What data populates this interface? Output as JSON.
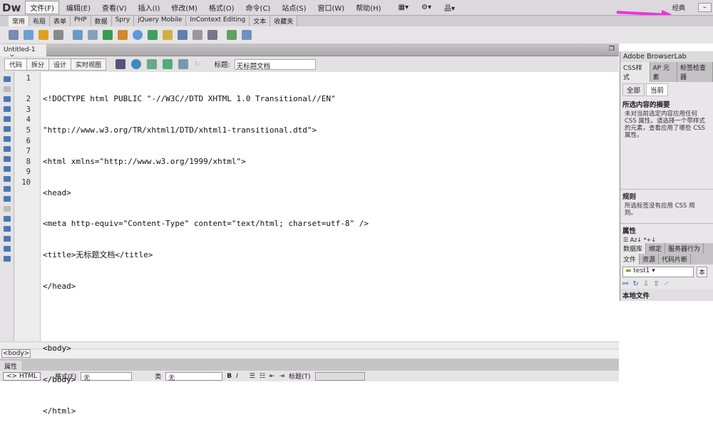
{
  "app": {
    "logo": "Dw",
    "workspace": "经典",
    "minimize": "–"
  },
  "menu": [
    "文件(F)",
    "编辑(E)",
    "查看(V)",
    "插入(I)",
    "修改(M)",
    "格式(O)",
    "命令(C)",
    "站点(S)",
    "窗口(W)",
    "帮助(H)"
  ],
  "insert_tabs": [
    "常用",
    "布局",
    "表单",
    "PHP",
    "数据",
    "Spry",
    "jQuery Mobile",
    "InContext Editing",
    "文本",
    "收藏夹"
  ],
  "document": {
    "tab": "Untitled-1",
    "close": "×",
    "views": [
      "代码",
      "拆分",
      "设计",
      "实时视图"
    ],
    "title_label": "标题:",
    "title_value": "无标题文档"
  },
  "code": {
    "line_numbers": [
      "1",
      "",
      "2",
      "3",
      "4",
      "5",
      "6",
      "7",
      "8",
      "9",
      "10"
    ],
    "lines": [
      "<!DOCTYPE html PUBLIC \"-//W3C//DTD XHTML 1.0 Transitional//EN\"",
      "\"http://www.w3.org/TR/xhtml1/DTD/xhtml1-transitional.dtd\">",
      "<html xmlns=\"http://www.w3.org/1999/xhtml\">",
      "<head>",
      "<meta http-equiv=\"Content-Type\" content=\"text/html; charset=utf-8\" />",
      "<title>无标题文档</title>",
      "</head>",
      "",
      "<body>",
      "</body>",
      "</html>"
    ]
  },
  "tag_selector": "<body>",
  "properties": {
    "tab": "属性",
    "html_button": "<> HTML",
    "format_label": "格式(F)",
    "format_value": "无",
    "class_label": "类",
    "class_value": "无",
    "bold": "B",
    "italic": "I",
    "heading_label": "标题(T)"
  },
  "panel": {
    "browserlab": "Adobe BrowserLab",
    "tabs": [
      "CSS样式",
      "AP 元素",
      "标签检查器"
    ],
    "modes": [
      "全部",
      "当前"
    ],
    "summary_title": "所选内容的摘要",
    "summary_text": "未对当前选定内容应用任何 CSS 属性。请选择一个带样式的元素，查看应用了哪些 CSS 属性。",
    "rules_title": "规则",
    "rules_text": "所选标签没有应用 CSS 规则。",
    "props_title": "属性",
    "tabs2": [
      "数据库",
      "绑定",
      "服务器行为"
    ],
    "tabs3": [
      "文件",
      "资源",
      "代码片断"
    ],
    "site": "test1",
    "view": "本",
    "local_files": "本地文件"
  },
  "colors": {
    "annotation_arrow": "#f030e0",
    "accent": "#4a78b5"
  }
}
